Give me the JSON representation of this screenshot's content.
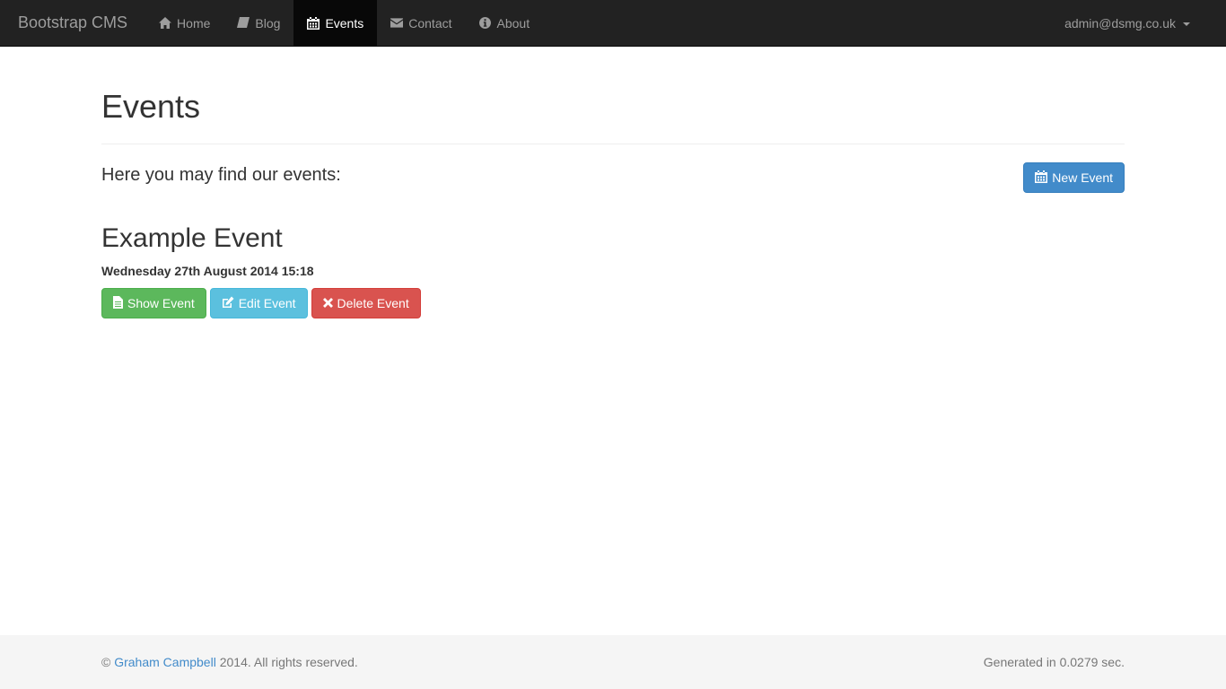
{
  "navbar": {
    "brand": "Bootstrap CMS",
    "items": [
      {
        "label": "Home",
        "icon": "home-icon",
        "active": false
      },
      {
        "label": "Blog",
        "icon": "book-icon",
        "active": false
      },
      {
        "label": "Events",
        "icon": "calendar-icon",
        "active": true
      },
      {
        "label": "Contact",
        "icon": "envelope-icon",
        "active": false
      },
      {
        "label": "About",
        "icon": "info-circle-icon",
        "active": false
      }
    ],
    "user": "admin@dsmg.co.uk"
  },
  "page": {
    "title": "Events",
    "intro": "Here you may find our events:",
    "new_event_label": "New Event"
  },
  "events": [
    {
      "title": "Example Event",
      "date": "Wednesday 27th August 2014 15:18",
      "show_label": "Show Event",
      "edit_label": "Edit Event",
      "delete_label": "Delete Event"
    }
  ],
  "footer": {
    "copyright_symbol": "©",
    "author": "Graham Campbell",
    "rights": "2014. All rights reserved.",
    "generated": "Generated in 0.0279 sec."
  },
  "colors": {
    "navbar_bg": "#222222",
    "primary": "#428bca",
    "success": "#5cb85c",
    "info": "#5bc0de",
    "danger": "#d9534f"
  }
}
